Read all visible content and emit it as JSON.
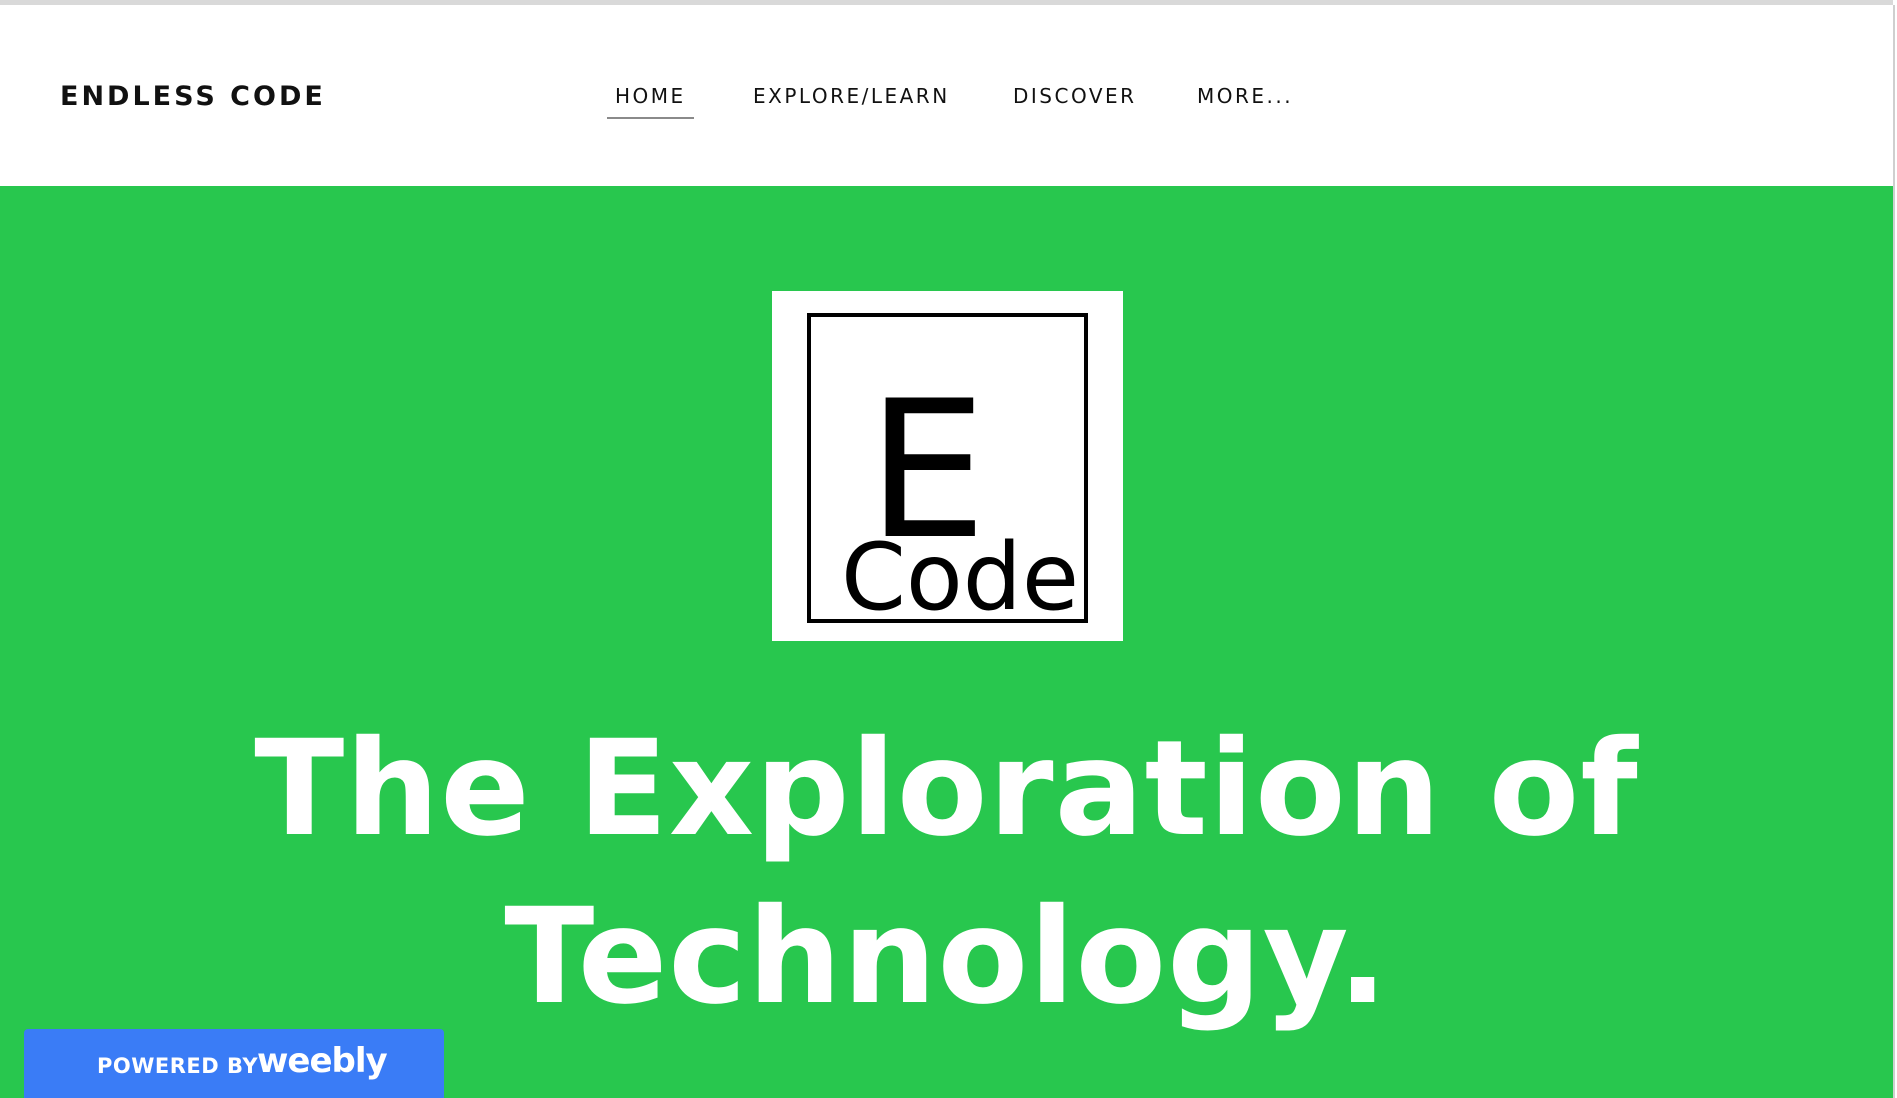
{
  "header": {
    "site_title": "ENDLESS CODE",
    "nav": [
      {
        "label": "HOME",
        "active": true
      },
      {
        "label": "EXPLORE/LEARN",
        "active": false
      },
      {
        "label": "DISCOVER",
        "active": false
      },
      {
        "label": "MORE..."
      }
    ]
  },
  "hero": {
    "logo": {
      "letter": "E",
      "word": "Code"
    },
    "headline_line1": "The Exploration of",
    "headline_line2": "Technology."
  },
  "badge": {
    "powered_by": "POWERED BY",
    "brand": "weebly"
  },
  "colors": {
    "hero_background": "#28c74e",
    "badge_background": "#3a7cf6",
    "header_background": "#ffffff",
    "headline_text": "#ffffff"
  }
}
